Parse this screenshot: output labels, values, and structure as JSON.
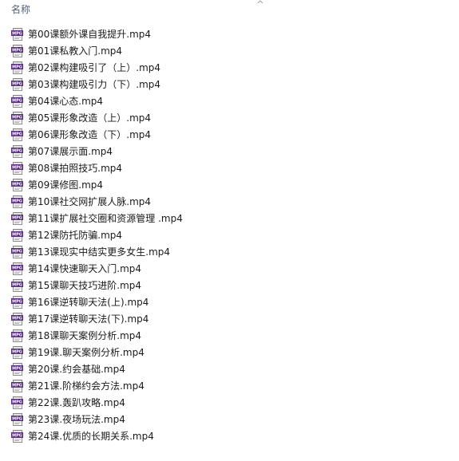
{
  "header": {
    "name_label": "名称"
  },
  "files": [
    {
      "name": "第00课额外课自我提升.mp4",
      "icon": "mp4-video-icon"
    },
    {
      "name": "第01课私教入门.mp4",
      "icon": "mp4-video-icon"
    },
    {
      "name": "第02课构建吸引了（上）.mp4",
      "icon": "mp4-video-icon"
    },
    {
      "name": "第03课构建吸引力（下）.mp4",
      "icon": "mp4-video-icon"
    },
    {
      "name": "第04课心态.mp4",
      "icon": "mp4-video-icon"
    },
    {
      "name": "第05课形象改造（上）.mp4",
      "icon": "mp4-video-icon"
    },
    {
      "name": "第06课形象改造（下）.mp4",
      "icon": "mp4-video-icon"
    },
    {
      "name": "第07课展示面.mp4",
      "icon": "mp4-video-icon"
    },
    {
      "name": "第08课拍照技巧.mp4",
      "icon": "mp4-video-icon"
    },
    {
      "name": "第09课修图.mp4",
      "icon": "mp4-video-icon"
    },
    {
      "name": "第10课社交网扩展人脉.mp4",
      "icon": "mp4-video-icon"
    },
    {
      "name": "第11课扩展社交圈和资源管理 .mp4",
      "icon": "mp4-video-icon"
    },
    {
      "name": "第12课防托防骗.mp4",
      "icon": "mp4-video-icon"
    },
    {
      "name": "第13课现实中结实更多女生.mp4",
      "icon": "mp4-video-icon"
    },
    {
      "name": "第14课快速聊天入门.mp4",
      "icon": "mp4-video-icon"
    },
    {
      "name": "第15课聊天技巧进阶.mp4",
      "icon": "mp4-video-icon"
    },
    {
      "name": "第16课逆转聊天法(上).mp4",
      "icon": "mp4-video-icon"
    },
    {
      "name": "第17课逆转聊天法(下).mp4",
      "icon": "mp4-video-icon"
    },
    {
      "name": "第18课聊天案例分析.mp4",
      "icon": "mp4-video-icon"
    },
    {
      "name": "第19课.聊天案例分析.mp4",
      "icon": "mp4-video-icon"
    },
    {
      "name": "第20课.约会基础.mp4",
      "icon": "mp4-video-icon"
    },
    {
      "name": "第21课.阶梯约会方法.mp4",
      "icon": "mp4-video-icon"
    },
    {
      "name": "第22课.轰趴攻略.mp4",
      "icon": "mp4-video-icon"
    },
    {
      "name": "第23课.夜场玩法.mp4",
      "icon": "mp4-video-icon"
    },
    {
      "name": "第24课.优质的长期关系.mp4",
      "icon": "mp4-video-icon"
    }
  ],
  "colors": {
    "header_text": "#4c607a",
    "file_text": "#1a1a1a",
    "icon_badge": "#5a2a8c"
  }
}
